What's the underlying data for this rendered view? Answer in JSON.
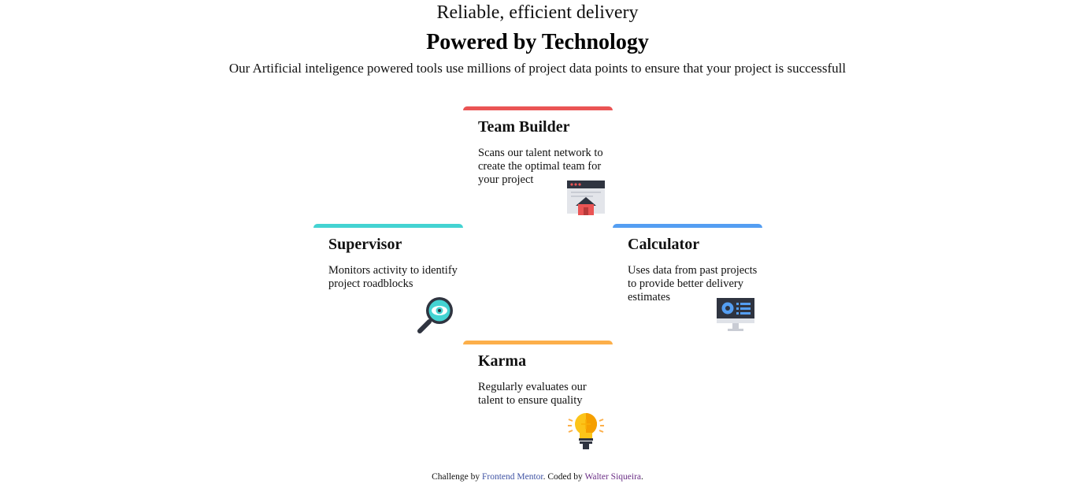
{
  "header": {
    "subtitle": "Reliable, efficient delivery",
    "title": "Powered by Technology",
    "intro": "Our Artificial inteligence powered tools use millions of project data points to ensure that your project is successfull"
  },
  "cards": [
    {
      "title": "Team Builder",
      "text": "Scans our talent network to create the optimal team for your project",
      "icon": "team-builder-icon",
      "accent": "#ea5454"
    },
    {
      "title": "Supervisor",
      "text": "Monitors activity to identify project roadblocks",
      "icon": "magnifier-eye-icon",
      "accent": "#44d3d2"
    },
    {
      "title": "Calculator",
      "text": "Uses data from past projects to provide better delivery estimates",
      "icon": "monitor-calculator-icon",
      "accent": "#549ef2"
    },
    {
      "title": "Karma",
      "text": "Regularly evaluates our talent to ensure quality",
      "icon": "lightbulb-icon",
      "accent": "#fcaf4a"
    }
  ],
  "footer": {
    "prefix": "Challenge by ",
    "challenge_link": "Frontend Mentor",
    "middle": ". Coded by ",
    "author_link": "Walter Siqueira",
    "suffix": "."
  }
}
